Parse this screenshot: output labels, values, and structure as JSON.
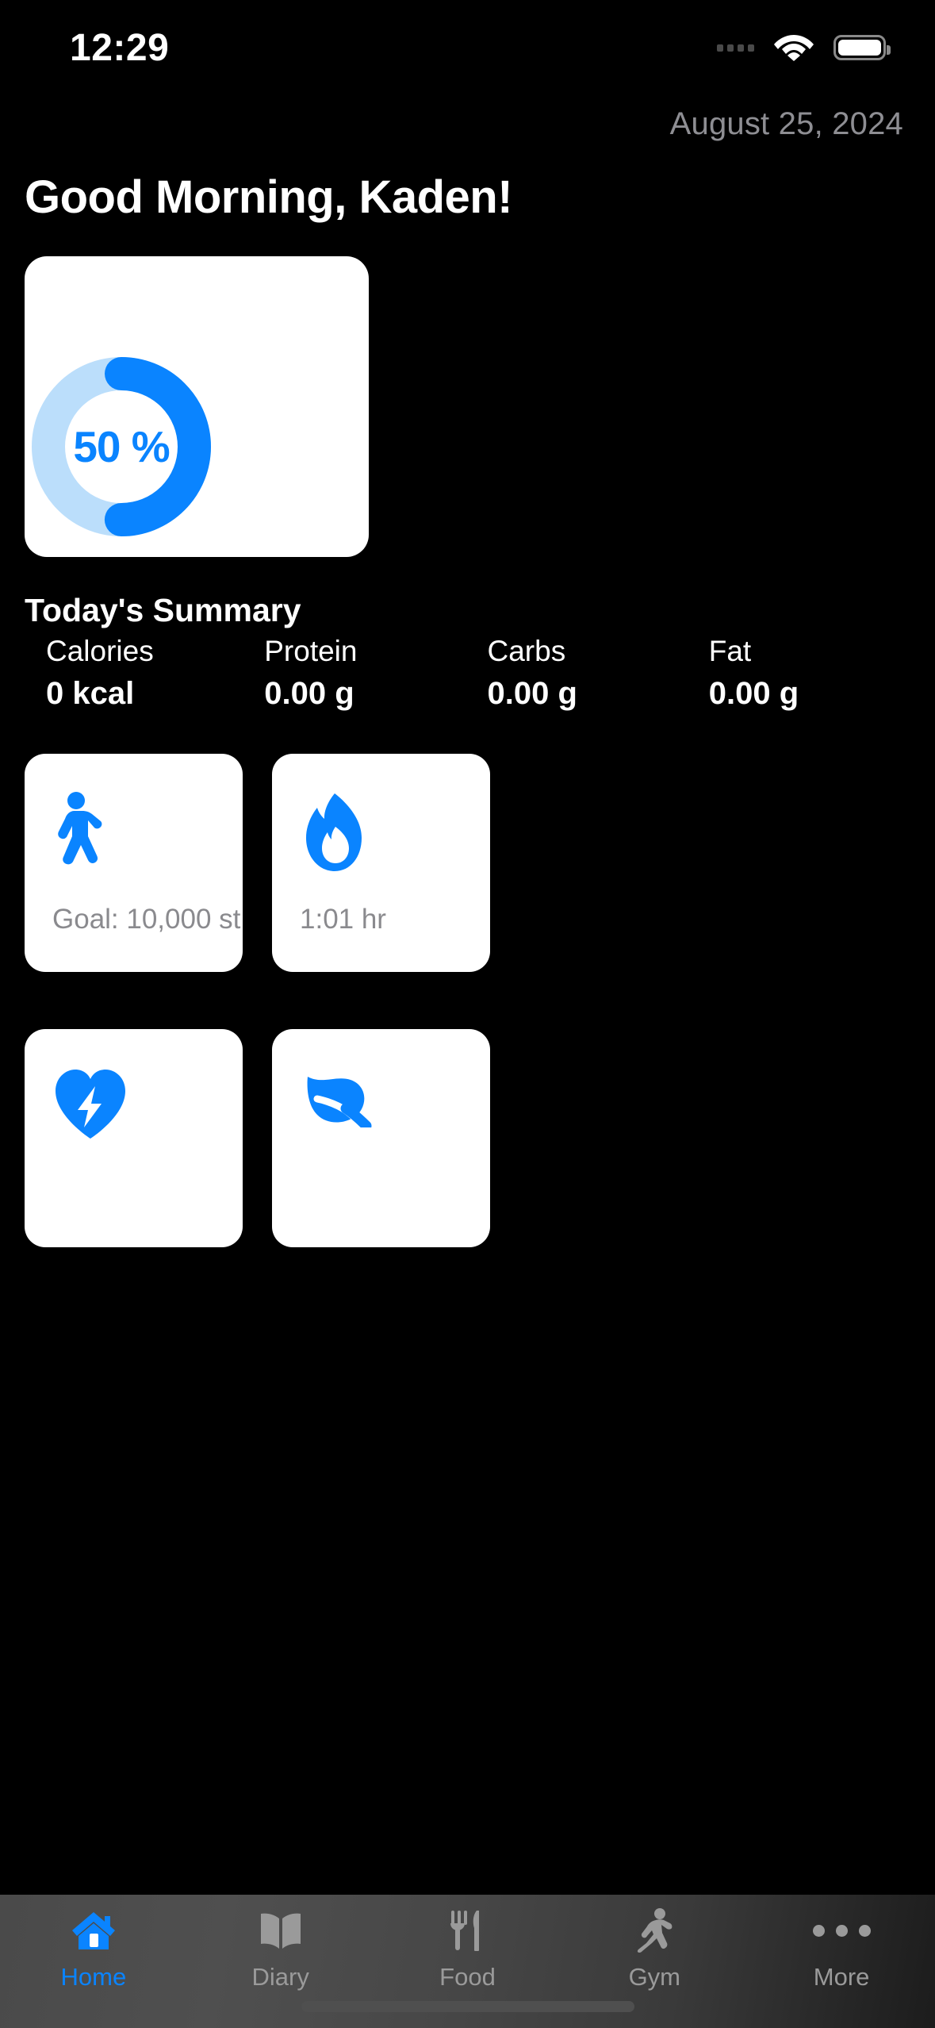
{
  "status_bar": {
    "time": "12:29",
    "signal_icon": "signal-dots-icon",
    "wifi_icon": "wifi-icon",
    "battery_icon": "battery-icon"
  },
  "header": {
    "date": "August 25, 2024",
    "greeting": "Good Morning, Kaden!"
  },
  "progress_card": {
    "percent_label": "50 %",
    "percent_value": 50,
    "ring_fill_color": "#0A84FF",
    "ring_track_color": "#BBDEFB",
    "card_background": "#FFFFFF"
  },
  "summary": {
    "title": "Today's Summary",
    "metrics": [
      {
        "label": "Calories",
        "value": "0 kcal"
      },
      {
        "label": "Protein",
        "value": "0.00 g"
      },
      {
        "label": "Carbs",
        "value": "0.00 g"
      },
      {
        "label": "Fat",
        "value": "0.00 g"
      }
    ]
  },
  "metric_cards": [
    {
      "icon": "walking-person-icon",
      "caption": "Goal: 10,000 st..."
    },
    {
      "icon": "flame-icon",
      "caption": "1:01 hr"
    },
    {
      "icon": "heart-bolt-icon",
      "caption": ""
    },
    {
      "icon": "leaf-icon",
      "caption": ""
    }
  ],
  "tab_bar": {
    "active_color": "#0A84FF",
    "inactive_color": "#9A9A9A",
    "items": [
      {
        "label": "Home",
        "icon": "house-icon",
        "active": true
      },
      {
        "label": "Diary",
        "icon": "open-book-icon",
        "active": false
      },
      {
        "label": "Food",
        "icon": "fork-knife-icon",
        "active": false
      },
      {
        "label": "Gym",
        "icon": "running-person-icon",
        "active": false
      },
      {
        "label": "More",
        "icon": "ellipsis-icon",
        "active": false
      }
    ]
  }
}
